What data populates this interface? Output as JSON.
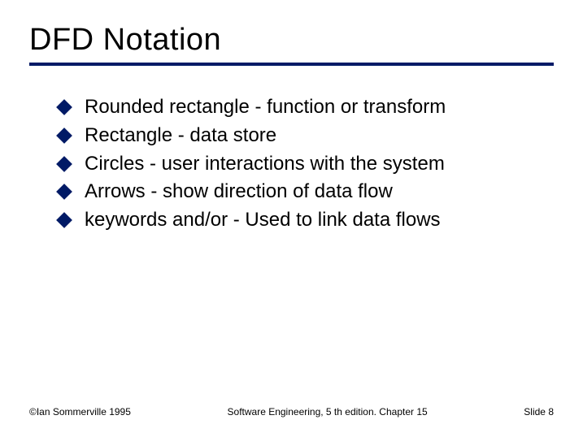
{
  "title": "DFD Notation",
  "bullets": [
    "Rounded rectangle - function or transform",
    "Rectangle - data store",
    "Circles - user interactions with the system",
    "Arrows - show direction of data flow",
    "keywords and/or - Used to link data flows"
  ],
  "footer": {
    "left": "©Ian Sommerville 1995",
    "center": "Software Engineering, 5 th edition. Chapter 15",
    "right": "Slide 8"
  },
  "colors": {
    "accent": "#001a66"
  }
}
